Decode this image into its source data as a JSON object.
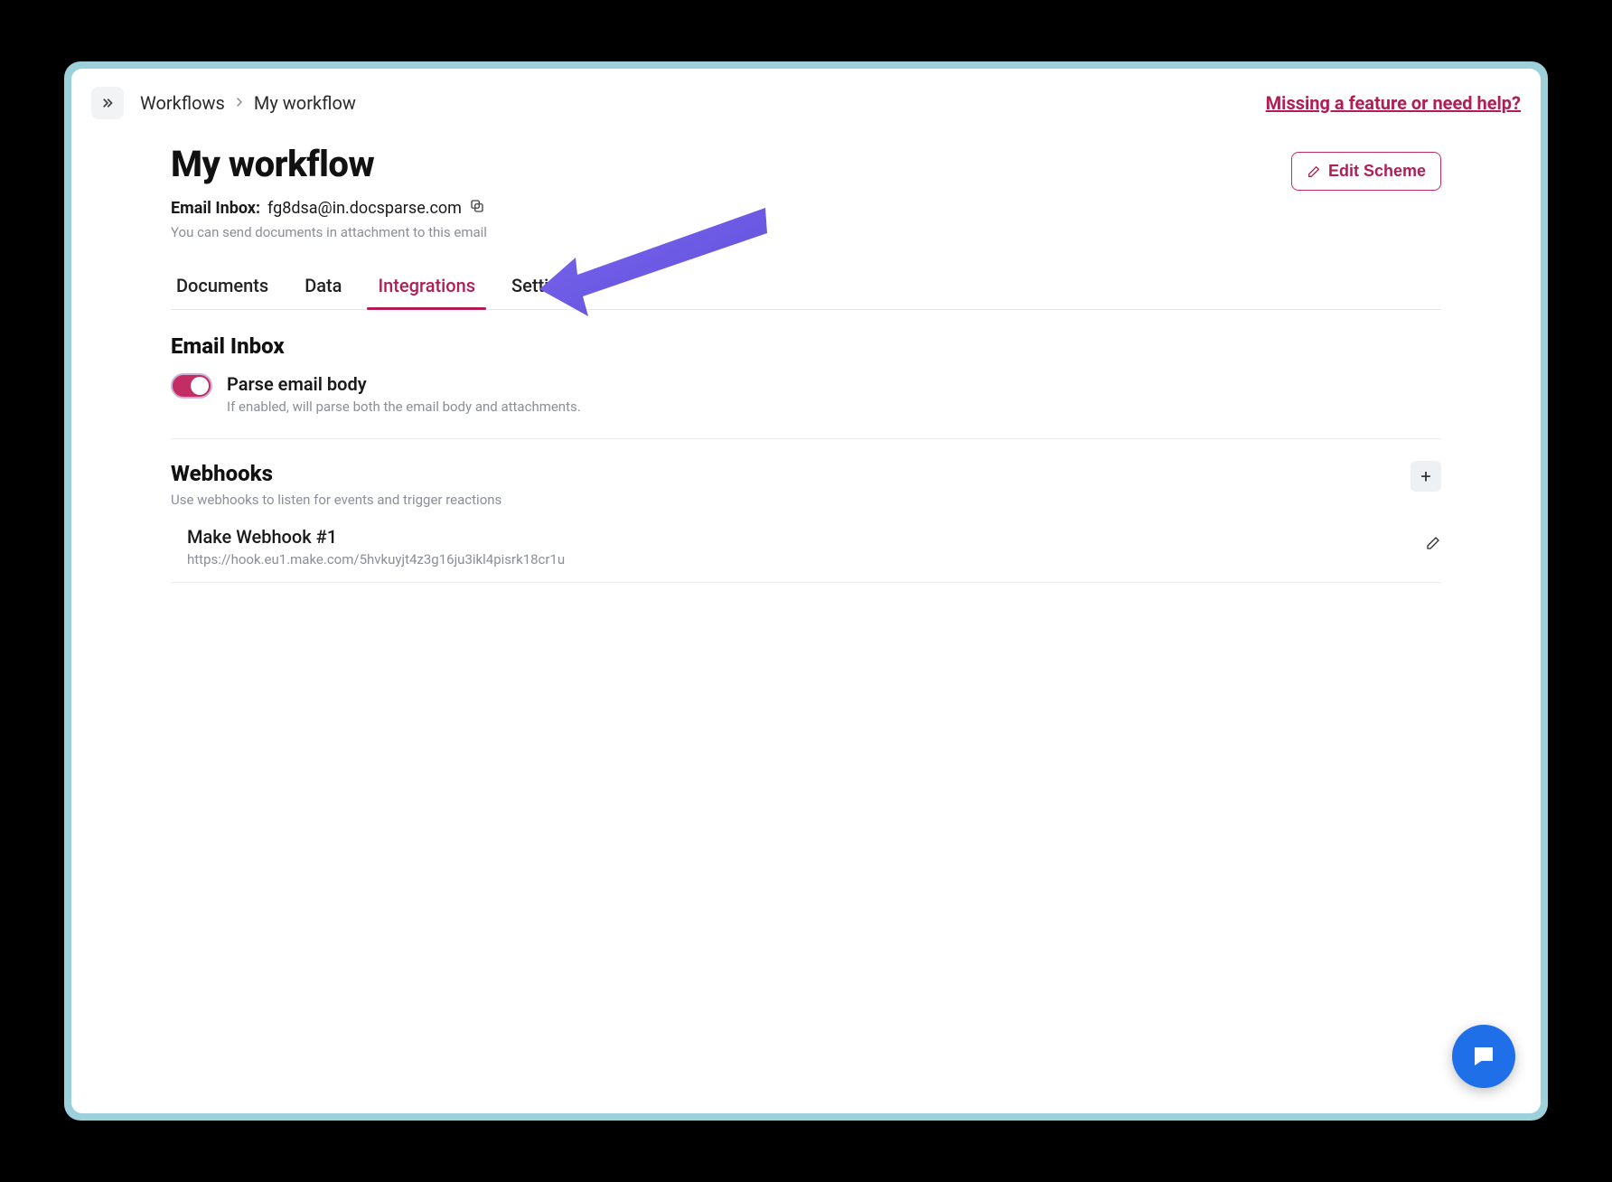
{
  "topbar": {
    "breadcrumb_root": "Workflows",
    "breadcrumb_current": "My workflow",
    "help_link": "Missing a feature or need help?"
  },
  "header": {
    "title": "My workflow",
    "email_label": "Email Inbox:",
    "email_value": "fg8dsa@in.docsparse.com",
    "email_hint": "You can send documents in attachment to this email",
    "edit_scheme": "Edit Scheme"
  },
  "tabs": {
    "documents": "Documents",
    "data": "Data",
    "integrations": "Integrations",
    "settings": "Settings"
  },
  "email_inbox": {
    "title": "Email Inbox",
    "toggle_title": "Parse email body",
    "toggle_desc": "If enabled, will parse both the email body and attachments."
  },
  "webhooks": {
    "title": "Webhooks",
    "hint": "Use webhooks to listen for events and trigger reactions",
    "items": [
      {
        "name": "Make Webhook #1",
        "url": "https://hook.eu1.make.com/5hvkuyjt4z3g16ju3ikl4pisrk18cr1u"
      }
    ]
  },
  "colors": {
    "accent": "#b11d55",
    "frame": "#9cd1db",
    "chat": "#1f6fe8",
    "arrow": "#6a57e6"
  }
}
